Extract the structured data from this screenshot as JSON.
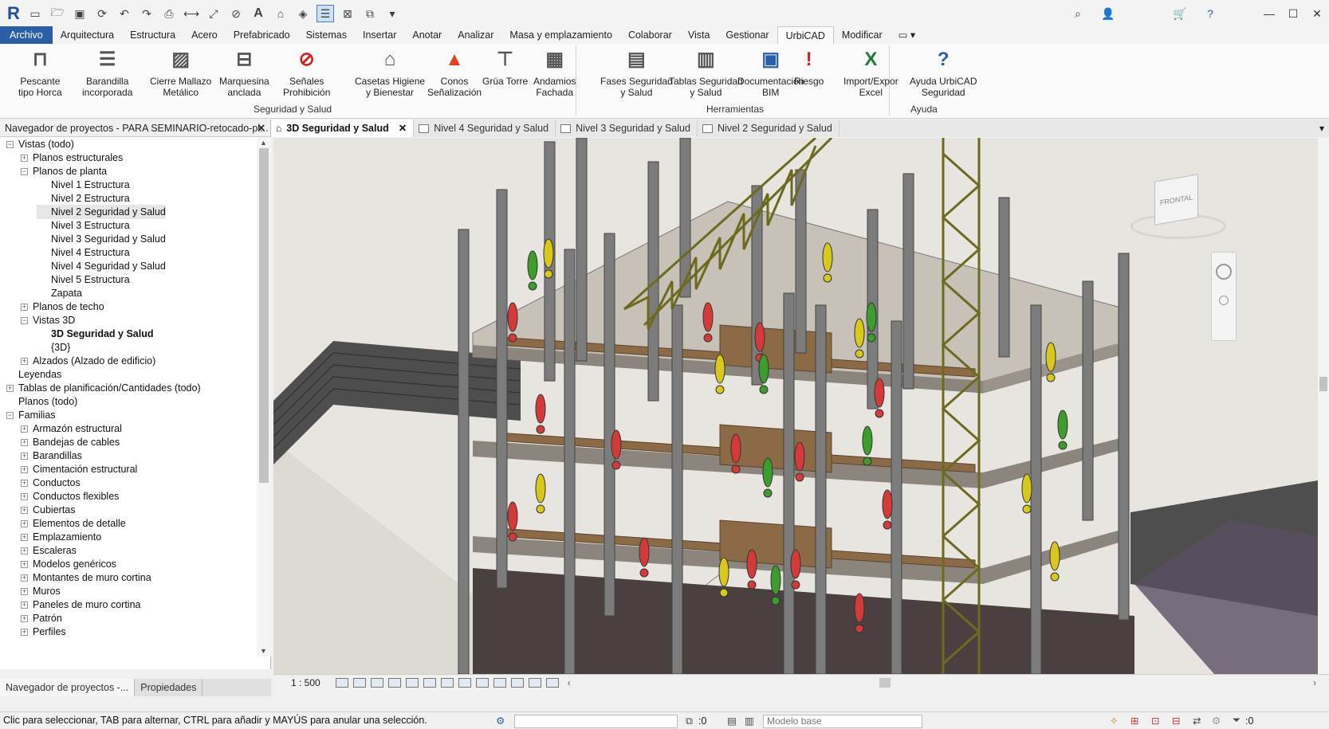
{
  "app": {
    "logo": "R"
  },
  "menu": {
    "tabs": [
      "Archivo",
      "Arquitectura",
      "Estructura",
      "Acero",
      "Prefabricado",
      "Sistemas",
      "Insertar",
      "Anotar",
      "Analizar",
      "Masa y emplazamiento",
      "Colaborar",
      "Vista",
      "Gestionar",
      "UrbiCAD",
      "Modificar"
    ],
    "active": "UrbiCAD"
  },
  "ribbon": {
    "buttons": [
      {
        "l1": "Pescante",
        "l2": "tipo Horca",
        "icon": "gallows-crane-icon"
      },
      {
        "l1": "Barandilla",
        "l2": "incorporada",
        "icon": "guardrail-icon"
      },
      {
        "l1": "Cierre Mallazo",
        "l2": "Metálico",
        "icon": "mesh-fence-icon"
      },
      {
        "l1": "Marquesina",
        "l2": "anclada",
        "icon": "canopy-icon"
      },
      {
        "l1": "Señales",
        "l2": "Prohibición",
        "icon": "prohibition-sign-icon"
      },
      {
        "l1": "Casetas Higiene",
        "l2": "y Bienestar",
        "icon": "hut-icon"
      },
      {
        "l1": "Conos",
        "l2": "Señalización",
        "icon": "traffic-cone-icon"
      },
      {
        "l1": "Grúa Torre",
        "l2": "",
        "icon": "tower-crane-icon"
      },
      {
        "l1": "Andamios",
        "l2": "Fachada",
        "icon": "scaffold-icon"
      },
      {
        "l1": "Fases Seguridad",
        "l2": "y Salud",
        "icon": "phases-icon"
      },
      {
        "l1": "Tablas Seguridad",
        "l2": "y Salud",
        "icon": "tables-icon"
      },
      {
        "l1": "Documentación",
        "l2": "BIM",
        "icon": "bim-doc-icon"
      },
      {
        "l1": "Riesgo",
        "l2": "",
        "icon": "risk-icon"
      },
      {
        "l1": "Import/Expor",
        "l2": "Excel",
        "icon": "excel-icon"
      },
      {
        "l1": "Ayuda UrbiCAD",
        "l2": "Seguridad",
        "icon": "help-icon"
      }
    ],
    "panels": [
      "Seguridad y Salud",
      "Herramientas",
      "Ayuda"
    ]
  },
  "browser": {
    "title": "Navegador de proyectos - PARA SEMINARIO-retocado-pl...",
    "tree": [
      {
        "t": "Vistas (todo)",
        "lvl": 0,
        "tog": "−"
      },
      {
        "t": "Planos estructurales",
        "lvl": 1,
        "tog": "+"
      },
      {
        "t": "Planos de planta",
        "lvl": 1,
        "tog": "−"
      },
      {
        "t": "Nivel 1 Estructura",
        "lvl": 2
      },
      {
        "t": "Nivel 2 Estructura",
        "lvl": 2
      },
      {
        "t": "Nivel 2 Seguridad y Salud",
        "lvl": 2,
        "sel": true
      },
      {
        "t": "Nivel 3 Estructura",
        "lvl": 2
      },
      {
        "t": "Nivel 3 Seguridad y Salud",
        "lvl": 2
      },
      {
        "t": "Nivel 4 Estructura",
        "lvl": 2
      },
      {
        "t": "Nivel 4 Seguridad y Salud",
        "lvl": 2
      },
      {
        "t": "Nivel 5 Estructura",
        "lvl": 2
      },
      {
        "t": "Zapata",
        "lvl": 2
      },
      {
        "t": "Planos de techo",
        "lvl": 1,
        "tog": "+"
      },
      {
        "t": "Vistas 3D",
        "lvl": 1,
        "tog": "−"
      },
      {
        "t": "3D Seguridad y Salud",
        "lvl": 2,
        "bold": true
      },
      {
        "t": "{3D}",
        "lvl": 2
      },
      {
        "t": "Alzados (Alzado de edificio)",
        "lvl": 1,
        "tog": "+"
      },
      {
        "t": "Leyendas",
        "lvl": 0
      },
      {
        "t": "Tablas de planificación/Cantidades (todo)",
        "lvl": 0,
        "tog": "+"
      },
      {
        "t": "Planos (todo)",
        "lvl": 0
      },
      {
        "t": "Familias",
        "lvl": 0,
        "tog": "−"
      },
      {
        "t": "Armazón estructural",
        "lvl": 1,
        "tog": "+"
      },
      {
        "t": "Bandejas de cables",
        "lvl": 1,
        "tog": "+"
      },
      {
        "t": "Barandillas",
        "lvl": 1,
        "tog": "+"
      },
      {
        "t": "Cimentación estructural",
        "lvl": 1,
        "tog": "+"
      },
      {
        "t": "Conductos",
        "lvl": 1,
        "tog": "+"
      },
      {
        "t": "Conductos flexibles",
        "lvl": 1,
        "tog": "+"
      },
      {
        "t": "Cubiertas",
        "lvl": 1,
        "tog": "+"
      },
      {
        "t": "Elementos de detalle",
        "lvl": 1,
        "tog": "+"
      },
      {
        "t": "Emplazamiento",
        "lvl": 1,
        "tog": "+"
      },
      {
        "t": "Escaleras",
        "lvl": 1,
        "tog": "+"
      },
      {
        "t": "Modelos genéricos",
        "lvl": 1,
        "tog": "+"
      },
      {
        "t": "Montantes de muro cortina",
        "lvl": 1,
        "tog": "+"
      },
      {
        "t": "Muros",
        "lvl": 1,
        "tog": "+"
      },
      {
        "t": "Paneles de muro cortina",
        "lvl": 1,
        "tog": "+"
      },
      {
        "t": "Patrón",
        "lvl": 1,
        "tog": "+"
      },
      {
        "t": "Perfiles",
        "lvl": 1,
        "tog": "+"
      }
    ],
    "bottom_tabs": [
      "Navegador de proyectos -...",
      "Propiedades"
    ]
  },
  "view_tabs": [
    "3D Seguridad y Salud",
    "Nivel 4 Seguridad y Salud",
    "Nivel 3 Seguridad y Salud",
    "Nivel 2 Seguridad y Salud"
  ],
  "viewcube": {
    "face": "FRONTAL"
  },
  "view_control": {
    "scale": "1 : 500"
  },
  "status": {
    "message": "Clic para seleccionar, TAB para alternar, CTRL para añadir y MAYÚS para anular una selección.",
    "count": ":0",
    "model": "Modelo base",
    "filter": ":0"
  }
}
